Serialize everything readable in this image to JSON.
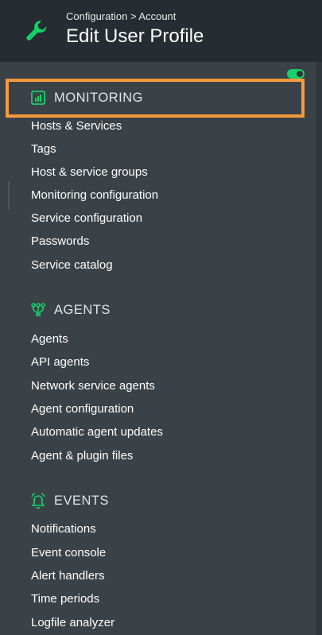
{
  "header": {
    "breadcrumb": "Configuration > Account",
    "title": "Edit User Profile"
  },
  "colors": {
    "accent": "#15d16a",
    "highlight": "#f4993a",
    "panel": "#3a4248",
    "header": "#262c31"
  },
  "sections": [
    {
      "title": "MONITORING",
      "icon": "bar-chart-icon",
      "items": [
        "Hosts & Services",
        "Tags",
        "Host & service groups",
        "Monitoring configuration",
        "Service configuration",
        "Passwords",
        "Service catalog"
      ]
    },
    {
      "title": "AGENTS",
      "icon": "network-agents-icon",
      "items": [
        "Agents",
        "API agents",
        "Network service agents",
        "Agent configuration",
        "Automatic agent updates",
        "Agent & plugin files"
      ]
    },
    {
      "title": "EVENTS",
      "icon": "bell-icon",
      "items": [
        "Notifications",
        "Event console",
        "Alert handlers",
        "Time periods",
        "Logfile analyzer"
      ]
    }
  ]
}
